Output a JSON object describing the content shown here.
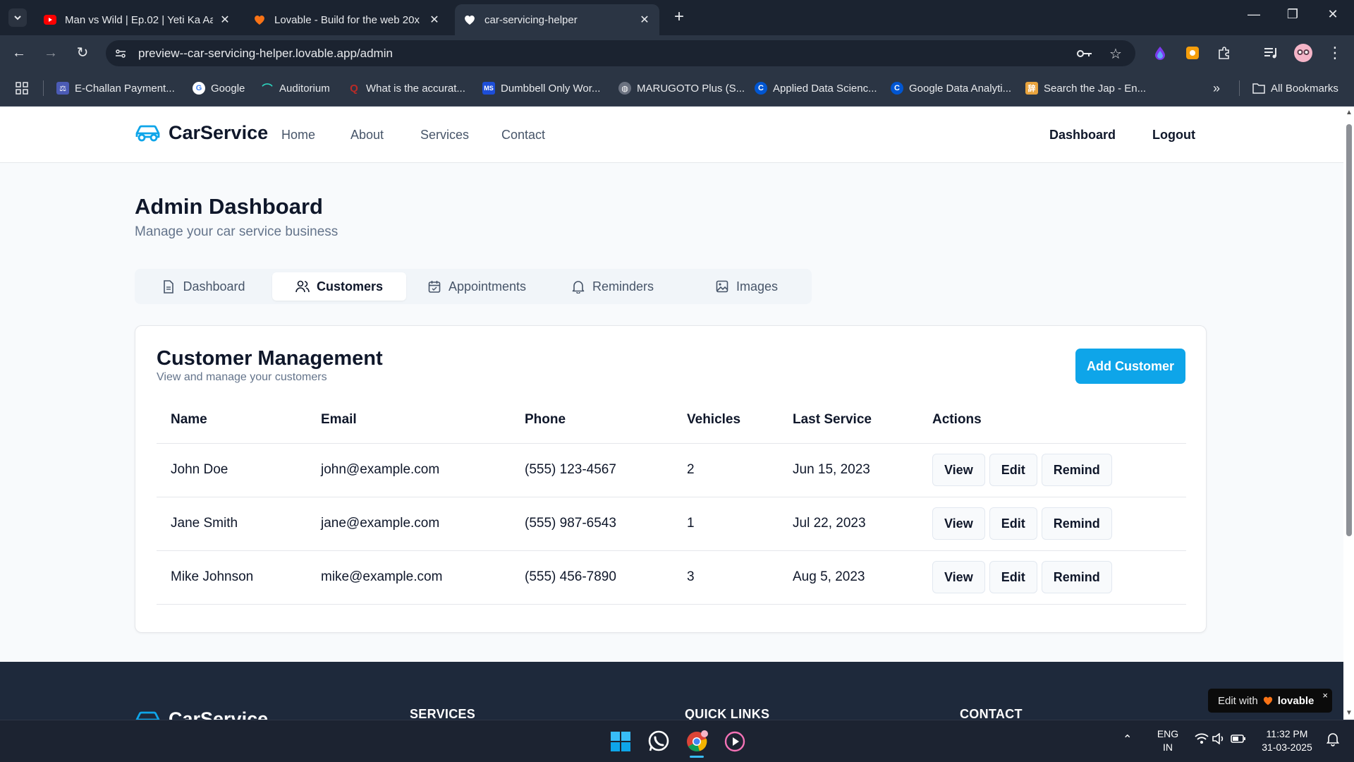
{
  "browser": {
    "tabs": [
      {
        "title": "Man vs Wild | Ep.02 | Yeti Ka Aat",
        "favicon": "youtube-icon",
        "active": false
      },
      {
        "title": "Lovable - Build for the web 20x",
        "favicon": "lovable-heart-icon",
        "active": false
      },
      {
        "title": "car-servicing-helper",
        "favicon": "heart-icon",
        "active": true
      }
    ],
    "url": "preview--car-servicing-helper.lovable.app/admin",
    "bookmarks": [
      {
        "label": "E-Challan Payment...",
        "icon": "echallan-icon"
      },
      {
        "label": "Google",
        "icon": "google-icon"
      },
      {
        "label": "Auditorium",
        "icon": "auditorium-icon"
      },
      {
        "label": "What is the accurat...",
        "icon": "quora-icon"
      },
      {
        "label": "Dumbbell Only Wor...",
        "icon": "ms-icon"
      },
      {
        "label": "MARUGOTO Plus (S...",
        "icon": "globe-icon"
      },
      {
        "label": "Applied Data Scienc...",
        "icon": "coursera-icon"
      },
      {
        "label": "Google Data Analyti...",
        "icon": "coursera-icon"
      },
      {
        "label": "Search the Jap - En...",
        "icon": "jisho-icon"
      }
    ],
    "all_bookmarks": "All Bookmarks",
    "overflow": "»"
  },
  "site": {
    "brand": "CarService",
    "nav": [
      "Home",
      "About",
      "Services",
      "Contact"
    ],
    "nav_right": {
      "dashboard": "Dashboard",
      "logout": "Logout"
    }
  },
  "page": {
    "title": "Admin Dashboard",
    "subtitle": "Manage your car service business",
    "tabs": [
      {
        "label": "Dashboard",
        "icon": "document-icon"
      },
      {
        "label": "Customers",
        "icon": "users-icon"
      },
      {
        "label": "Appointments",
        "icon": "calendar-icon"
      },
      {
        "label": "Reminders",
        "icon": "bell-icon"
      },
      {
        "label": "Images",
        "icon": "image-icon"
      }
    ],
    "active_tab": "Customers"
  },
  "customers": {
    "title": "Customer Management",
    "subtitle": "View and manage your customers",
    "add_button": "Add Customer",
    "columns": [
      "Name",
      "Email",
      "Phone",
      "Vehicles",
      "Last Service",
      "Actions"
    ],
    "rows": [
      {
        "name": "John Doe",
        "email": "john@example.com",
        "phone": "(555) 123-4567",
        "vehicles": "2",
        "last_service": "Jun 15, 2023"
      },
      {
        "name": "Jane Smith",
        "email": "jane@example.com",
        "phone": "(555) 987-6543",
        "vehicles": "1",
        "last_service": "Jul 22, 2023"
      },
      {
        "name": "Mike Johnson",
        "email": "mike@example.com",
        "phone": "(555) 456-7890",
        "vehicles": "3",
        "last_service": "Aug 5, 2023"
      }
    ],
    "actions": {
      "view": "View",
      "edit": "Edit",
      "remind": "Remind"
    }
  },
  "footer": {
    "brand": "CarService",
    "headings": [
      "SERVICES",
      "QUICK LINKS",
      "CONTACT"
    ]
  },
  "badge": {
    "prefix": "Edit with",
    "brand": "lovable",
    "close": "×"
  },
  "taskbar": {
    "lang": "ENG",
    "region": "IN",
    "time": "11:32 PM",
    "date": "31-03-2025"
  },
  "colors": {
    "accent": "#0ea5e9",
    "footer": "#1e293b",
    "chrome": "#202124"
  }
}
